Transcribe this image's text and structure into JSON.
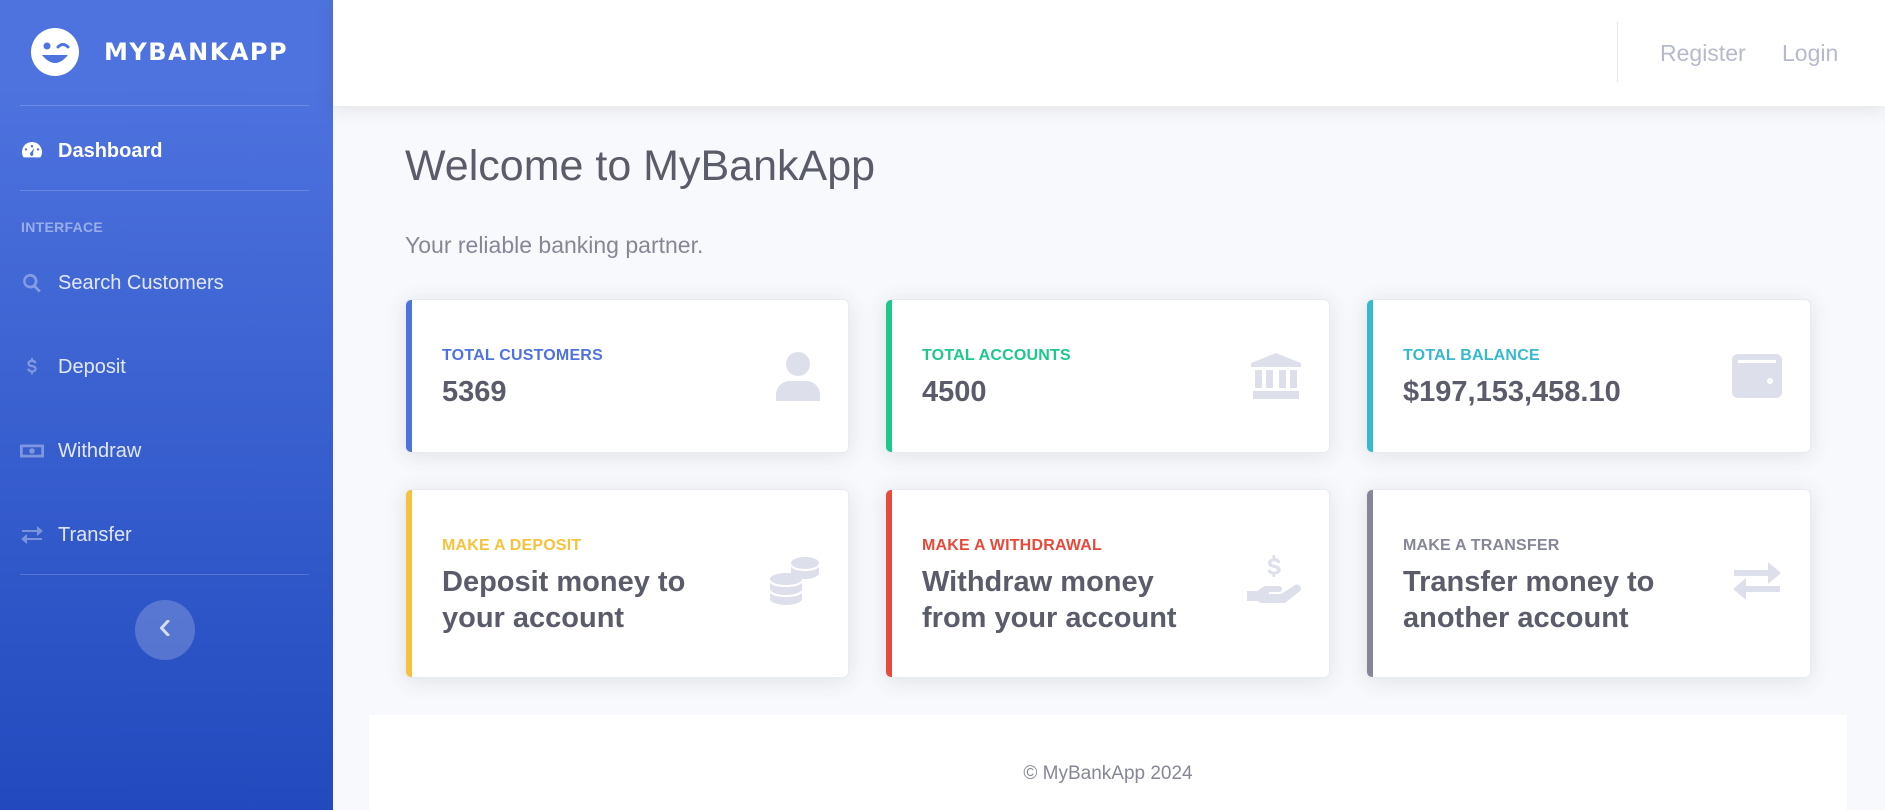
{
  "brand": {
    "name": "MYBANKAPP",
    "logo_icon": "laugh-wink-icon"
  },
  "sidebar": {
    "dashboard": {
      "label": "Dashboard",
      "icon": "tachometer-icon"
    },
    "heading": "INTERFACE",
    "items": [
      {
        "label": "Search Customers",
        "icon": "search-icon"
      },
      {
        "label": "Deposit",
        "icon": "dollar-icon"
      },
      {
        "label": "Withdraw",
        "icon": "money-bill-icon"
      },
      {
        "label": "Transfer",
        "icon": "exchange-icon"
      }
    ],
    "toggle_icon": "chevron-left-icon"
  },
  "topbar": {
    "register": "Register",
    "login": "Login"
  },
  "main": {
    "title": "Welcome to MyBankApp",
    "subtitle": "Your reliable banking partner.",
    "stats": [
      {
        "label": "TOTAL CUSTOMERS",
        "value": "5369",
        "color": "#4e73df",
        "icon": "user-icon"
      },
      {
        "label": "TOTAL ACCOUNTS",
        "value": "4500",
        "color": "#1cc88a",
        "icon": "bank-icon"
      },
      {
        "label": "TOTAL BALANCE",
        "value": "$197,153,458.10",
        "color": "#36b9cc",
        "icon": "wallet-icon"
      }
    ],
    "actions": [
      {
        "label": "MAKE A DEPOSIT",
        "text": "Deposit money to your account",
        "line1": "Deposit money to",
        "line2": "your account",
        "color": "#f6c23e",
        "icon": "coins-icon"
      },
      {
        "label": "MAKE A WITHDRAWAL",
        "text": "Withdraw money from your account",
        "line1": "Withdraw money",
        "line2": "from your account",
        "color": "#e74a3b",
        "icon": "hand-holding-dollar-icon"
      },
      {
        "label": "MAKE A TRANSFER",
        "text": "Transfer money to another account",
        "line1": "Transfer money to",
        "line2": "another account",
        "color": "#858796",
        "icon": "exchange-icon"
      }
    ]
  },
  "footer": {
    "copyright": "© MyBankApp 2024"
  }
}
